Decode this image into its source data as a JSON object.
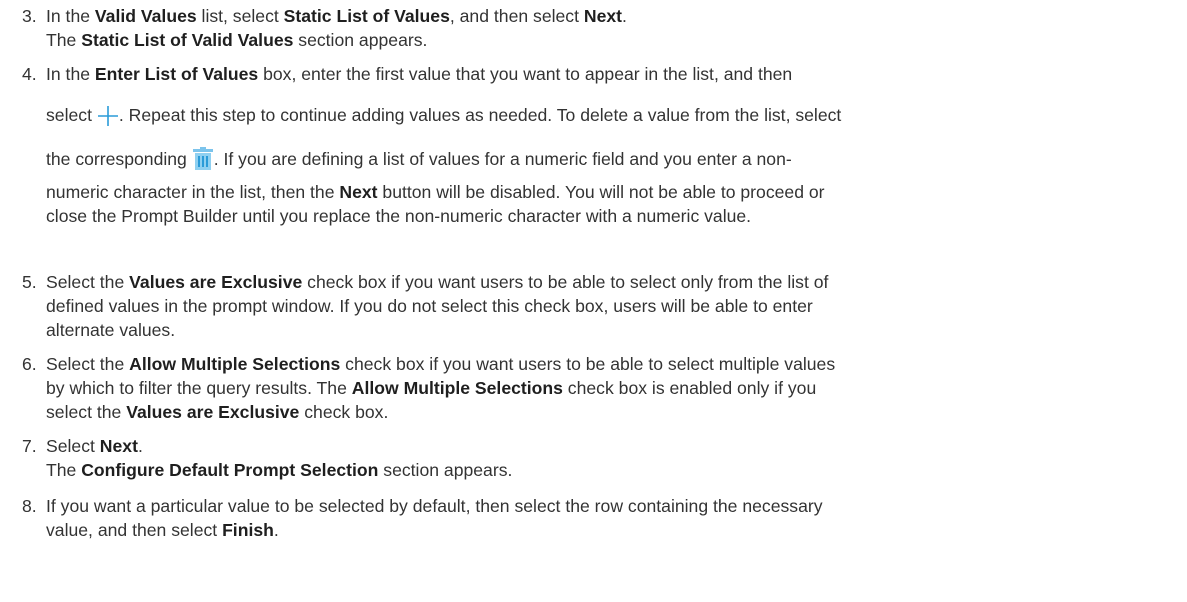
{
  "steps": [
    {
      "number": "3.",
      "line1": {
        "t1": "In the ",
        "b1": "Valid Values",
        "t2": " list, select ",
        "b2": "Static List of Values",
        "t3": ", and then select ",
        "b3": "Next",
        "t4": "."
      },
      "line2": {
        "t1": "The ",
        "b1": "Static List of Valid Values",
        "t2": " section appears."
      }
    },
    {
      "number": "4.",
      "line1": {
        "t1": "In the ",
        "b1": "Enter List of Values",
        "t2": " box, enter the first value that you want to appear in the list, and then"
      },
      "line2": {
        "t1": "select ",
        "t2": ". Repeat this step to continue adding values as needed. To delete a value from the list, select"
      },
      "line3": {
        "t1": "the corresponding ",
        "t2": ". If you are defining a list of values for a numeric field and you enter a non-"
      },
      "line4": {
        "t1": "numeric character in the list, then the ",
        "b1": "Next",
        "t2": " button will be disabled. You will not be able to proceed or"
      },
      "line5": {
        "t1": "close the Prompt Builder until you replace the non-numeric character with a numeric value."
      },
      "add_icon": "plus-icon",
      "delete_icon": "trash-icon"
    },
    {
      "number": "5.",
      "line1": {
        "t1": "Select the ",
        "b1": "Values are Exclusive",
        "t2": " check box if you want users to be able to select only from the list of"
      },
      "line2": {
        "t1": "defined values in the prompt window. If you do not select this check box, users will be able to enter"
      },
      "line3": {
        "t1": "alternate values."
      }
    },
    {
      "number": "6.",
      "line1": {
        "t1": "Select the ",
        "b1": "Allow Multiple Selections",
        "t2": " check box if you want users to be able to select multiple values"
      },
      "line2": {
        "t1": "by which to filter the query results. The ",
        "b1": "Allow Multiple Selections",
        "t2": " check box is enabled only if you"
      },
      "line3": {
        "t1": "select the ",
        "b1": "Values are Exclusive",
        "t2": " check box."
      }
    },
    {
      "number": "7.",
      "line1": {
        "t1": "Select ",
        "b1": "Next",
        "t2": "."
      },
      "line2": {
        "t1": "The ",
        "b1": "Configure Default Prompt Selection",
        "t2": " section appears."
      }
    },
    {
      "number": "8.",
      "line1": {
        "t1": "If you want a particular value to be selected by default, then select the row containing the necessary"
      },
      "line2": {
        "t1": "value, and then select ",
        "b1": "Finish",
        "t2": "."
      }
    }
  ],
  "colors": {
    "text": "#333333",
    "bold": "#1f1f1f",
    "icon_accent": "#2a9bd8"
  }
}
